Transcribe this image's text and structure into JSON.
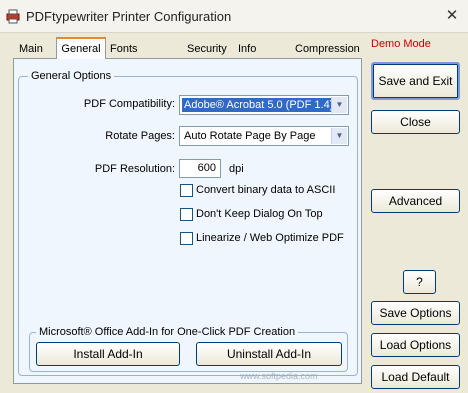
{
  "window": {
    "title": "PDFtypewriter Printer Configuration",
    "close_label": "✕"
  },
  "tabs": [
    "Main",
    "General",
    "Fonts / Colors",
    "Security",
    "Info Tags",
    "Compression"
  ],
  "demo_mode": "Demo Mode",
  "general": {
    "group_title": "General Options",
    "compat_label": "PDF Compatibility:",
    "compat_value": "Adobe® Acrobat 5.0 (PDF 1.4)",
    "rotate_label": "Rotate Pages:",
    "rotate_value": "Auto Rotate Page By Page",
    "resolution_label": "PDF Resolution:",
    "resolution_value": "600",
    "resolution_unit": "dpi",
    "checkboxes": [
      "Convert binary data to ASCII",
      "Don't Keep Dialog On Top",
      "Linearize / Web Optimize PDF"
    ]
  },
  "addin": {
    "group_title": "Microsoft® Office Add-In for One-Click PDF Creation",
    "install_label": "Install Add-In",
    "uninstall_label": "Uninstall Add-In"
  },
  "buttons": {
    "save_exit": "Save and Exit",
    "close": "Close",
    "advanced": "Advanced",
    "help": "?",
    "save_options": "Save Options",
    "load_options": "Load Options",
    "load_default": "Load Default"
  },
  "watermark": "www.softpedia.com"
}
